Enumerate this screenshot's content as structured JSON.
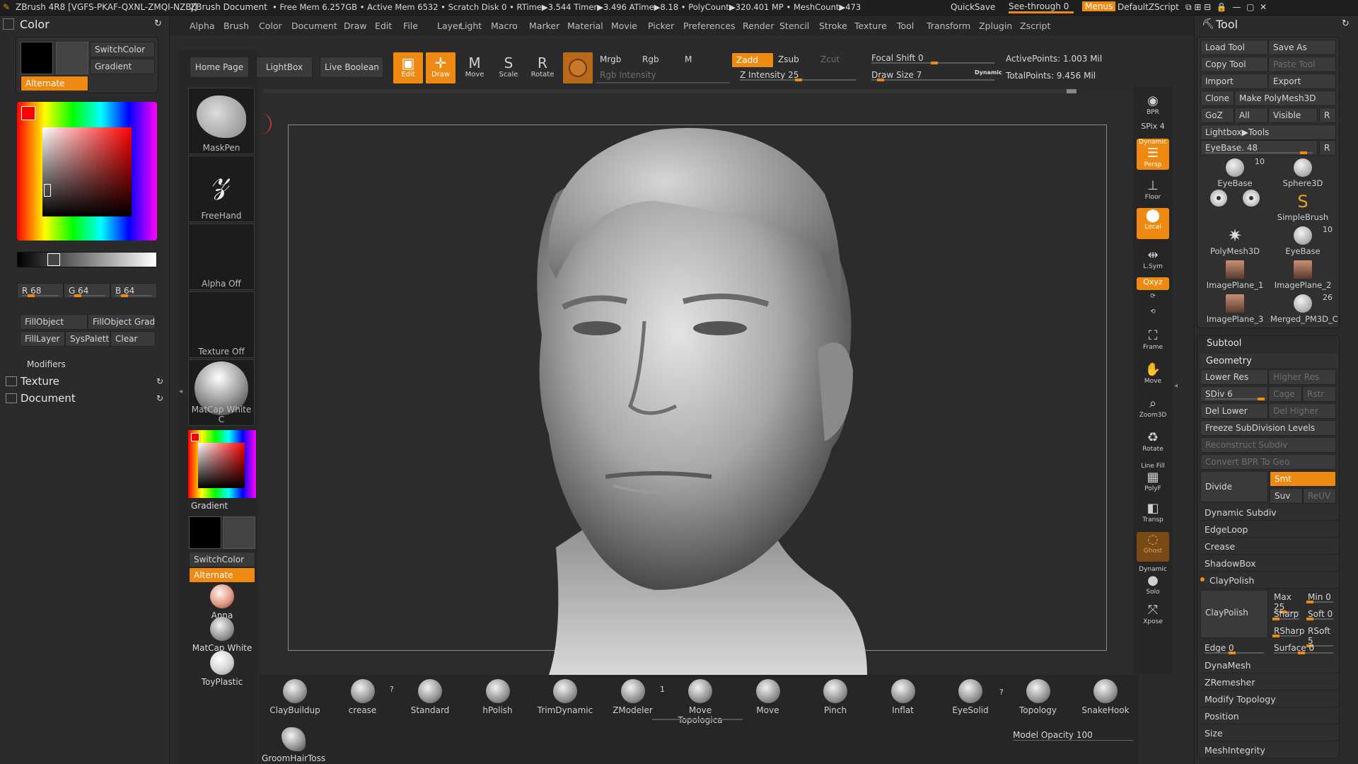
{
  "title_bar": {
    "app": "ZBrush 4R8 [VGFS-PKAF-QXNL-ZMQI-NZBJ]",
    "document": "ZBrush Document",
    "stats": "• Free Mem 6.257GB • Active Mem 6532 • Scratch Disk 0 • RTime▶3.544 Timer▶3.496 ATime▶8.18 • PolyCount▶320.401 MP • MeshCount▶473",
    "quicksave": "QuickSave",
    "seethrough": "See-through 0",
    "menus": "Menus",
    "script": "DefaultZScript"
  },
  "menu": [
    "Alpha",
    "Brush",
    "Color",
    "Document",
    "Draw",
    "Edit",
    "File",
    "Layer",
    "Light",
    "Macro",
    "Marker",
    "Material",
    "Movie",
    "Picker",
    "Preferences",
    "Render",
    "Stencil",
    "Stroke",
    "Texture",
    "Tool",
    "Transform",
    "Zplugin",
    "Zscript"
  ],
  "left": {
    "color_title": "Color",
    "switch_color": "SwitchColor",
    "gradient": "Gradient",
    "alternate": "Alternate",
    "r": "R 68",
    "g": "G 64",
    "b": "B 64",
    "fill_object": "FillObject",
    "fill_object_grad": "FillObject Grad",
    "fill_layer": "FillLayer",
    "sys_palette": "SysPalette",
    "clear": "Clear",
    "modifiers": "Modifiers",
    "texture": "Texture",
    "document": "Document"
  },
  "shelf": {
    "maskpen": "MaskPen",
    "freehand": "FreeHand",
    "alpha_off": "Alpha Off",
    "texture_off": "Texture Off",
    "matcap_white": "MatCap White C",
    "gradient": "Gradient",
    "switch_color": "SwitchColor",
    "alternate": "Alternate",
    "anna": "Anna",
    "matcap_white2": "MatCap White C",
    "toyplastic": "ToyPlastic"
  },
  "top_toolbar": {
    "home": "Home Page",
    "lightbox": "LightBox",
    "live_boolean": "Live Boolean",
    "edit": "Edit",
    "draw": "Draw",
    "move": "Move",
    "scale": "Scale",
    "rotate": "Rotate",
    "mrgb": "Mrgb",
    "rgb": "Rgb",
    "m": "M",
    "zadd": "Zadd",
    "zsub": "Zsub",
    "zcut": "Zcut",
    "rgb_intensity": "Rgb Intensity",
    "z_intensity": "Z Intensity 25",
    "focal_shift": "Focal Shift 0",
    "draw_size": "Draw Size 7",
    "dynamic": "Dynamic",
    "active_points": "ActivePoints: 1.003 Mil",
    "total_points": "TotalPoints: 9.456 Mil"
  },
  "right_strip": {
    "bpr": "BPR",
    "spix": "SPix 4",
    "dynamic": "Dynamic",
    "persp": "Persp",
    "floor": "Floor",
    "local": "Local",
    "lsym": "L.Sym",
    "xyz": "Qxyz",
    "frame": "Frame",
    "move": "Move",
    "zoom3d": "Zoom3D",
    "rotate": "Rotate",
    "line_fill": "Line Fill",
    "polyf": "PolyF",
    "transp": "Transp",
    "ghost": "Ghost",
    "solo": "Solo",
    "xpose": "Xpose"
  },
  "brushes": [
    {
      "name": "ClayBuildup"
    },
    {
      "name": "crease"
    },
    {
      "name": "Standard"
    },
    {
      "name": "hPolish"
    },
    {
      "name": "TrimDynamic"
    },
    {
      "name": "ZModeler"
    },
    {
      "name": "Move Topologica"
    },
    {
      "name": "Move"
    },
    {
      "name": "Pinch"
    },
    {
      "name": "Inflat"
    },
    {
      "name": "EyeSolid"
    },
    {
      "name": "Topology"
    },
    {
      "name": "SnakeHook"
    }
  ],
  "groom": "GroomHairToss",
  "model_opacity": "Model Opacity 100",
  "tool": {
    "title": "Tool",
    "load_tool": "Load Tool",
    "save_as": "Save As",
    "copy_tool": "Copy Tool",
    "paste_tool": "Paste Tool",
    "import": "Import",
    "export": "Export",
    "clone": "Clone",
    "make_polymesh": "Make PolyMesh3D",
    "goz": "GoZ",
    "all": "All",
    "visible": "Visible",
    "r": "R",
    "lightbox_tools": "Lightbox▶Tools",
    "eyebase_slider": "EyeBase. 48",
    "thumbs": [
      {
        "name": "EyeBase",
        "count": "10"
      },
      {
        "name": "Sphere3D"
      },
      {
        "name": "SimpleBrush"
      },
      {
        "name": "PolyMesh3D"
      },
      {
        "name": "EyeBase",
        "count": "10"
      },
      {
        "name": "ImagePlane_1"
      },
      {
        "name": "ImagePlane_2"
      },
      {
        "name": "ImagePlane_3"
      },
      {
        "name": "Merged_PM3D_C",
        "count": "26"
      }
    ],
    "subtool": "Subtool",
    "geometry": "Geometry",
    "lower_res": "Lower Res",
    "higher_res": "Higher Res",
    "sdiv": "SDiv 6",
    "cage": "Cage",
    "rstr": "Rstr",
    "del_lower": "Del Lower",
    "del_higher": "Del Higher",
    "freeze": "Freeze SubDivision Levels",
    "reconstruct": "Reconstruct Subdiv",
    "convert_bpr": "Convert BPR To Geo",
    "divide": "Divide",
    "smt": "Smt",
    "suv": "Suv",
    "reuv": "ReUV",
    "dynamic_subdiv": "Dynamic Subdiv",
    "edgeloop": "EdgeLoop",
    "crease": "Crease",
    "shadowbox": "ShadowBox",
    "claypolish": "ClayPolish",
    "max": "Max 25",
    "min": "Min 0",
    "sharp": "Sharp",
    "soft": "Soft 0",
    "rsharp": "RSharp",
    "rsoft": "RSoft 5",
    "edge": "Edge 0",
    "surface": "Surface 0",
    "dynamesh": "DynaMesh",
    "zremesher": "ZRemesher",
    "modify_topology": "Modify Topology",
    "position": "Position",
    "size": "Size",
    "meshintegrity": "MeshIntegrity"
  }
}
